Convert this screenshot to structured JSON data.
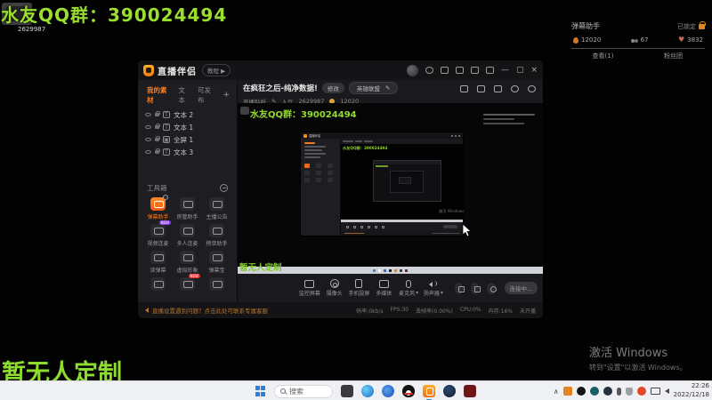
{
  "overlay": {
    "qq_text": "水友QQ群：390024494",
    "viewer_id": "2629987",
    "bottom_text": "暂无人定制",
    "activate_title": "激活 Windows",
    "activate_sub": "转到\"设置\"以激活 Windows。"
  },
  "danmaku_panel": {
    "title": "弹幕助手",
    "locked_label": "已锁定",
    "stats": [
      {
        "icon": "fire-icon",
        "value": "12020"
      },
      {
        "icon": "users-icon",
        "value": "67"
      },
      {
        "icon": "heart-icon",
        "value": "3832"
      }
    ],
    "tabs": [
      "查看(1)",
      "粉丝团"
    ]
  },
  "app": {
    "logo_text": "直播伴侣",
    "logo_badge": "教程 ▶",
    "sidebar": {
      "tabs": [
        "我的素材",
        "文本",
        "可发布"
      ],
      "sources": [
        {
          "label": "文本 2",
          "type": "T"
        },
        {
          "label": "文本 1",
          "type": "T"
        },
        {
          "label": "全屏 1",
          "type": "▣"
        },
        {
          "label": "文本 3",
          "type": "T"
        }
      ],
      "toolbox_title": "工具箱",
      "tools": [
        {
          "label": "弹幕助手"
        },
        {
          "label": "房管助手"
        },
        {
          "label": "主播公告"
        },
        {
          "label": "视频连麦",
          "badge": "NEW"
        },
        {
          "label": "多人连麦"
        },
        {
          "label": "榜单助手"
        },
        {
          "label": "读弹幕"
        },
        {
          "label": "虚拟形象"
        },
        {
          "label": "弹幕宝"
        }
      ]
    },
    "header": {
      "title": "在疯狂之后-纯净数据!",
      "edit_button": "修改",
      "category": "英雄联盟",
      "sticker_label": "开播贴纸",
      "popularity_label": "人气",
      "popularity_value": "2629987",
      "coin_value": "12020"
    },
    "toolbar": {
      "items": [
        "监控屏幕",
        "摄像头",
        "手机投屏",
        "多媒体",
        "麦克风",
        "扬声器"
      ],
      "status_button": "连接中..."
    },
    "statusbar": {
      "notice": "直播设置遇到问题？点击此处可联系专属客服",
      "metrics": [
        "码率:0kb/s",
        "FPS:30",
        "丢帧率(0.00%)",
        "CPU:0%",
        "内存:16%",
        "未开播"
      ]
    }
  },
  "taskbar": {
    "search_placeholder": "搜索",
    "time": "22:26",
    "date": "2022/12/18"
  },
  "glyphs": {
    "pencil": "✎",
    "dropdown": "▾",
    "plus": "+",
    "minimize": "—",
    "maximize": "▢",
    "close": "×",
    "chevron_up": "∧",
    "heart": "♥"
  }
}
